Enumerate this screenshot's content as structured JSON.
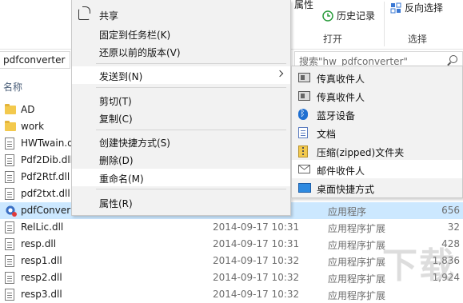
{
  "ribbon": {
    "properties_label": "属性",
    "history_label": "历史记录",
    "invert_selection_label": "反向选择",
    "open_group": "打开",
    "select_group": "选择"
  },
  "address": {
    "path": "pdfconverter",
    "search_placeholder": "搜索\"hw_pdfconverter\""
  },
  "column_header": {
    "name": "名称"
  },
  "files": [
    {
      "name": "AD",
      "date": "",
      "type": "",
      "size": "",
      "icon": "folder-icon"
    },
    {
      "name": "work",
      "date": "",
      "type": "",
      "size": "",
      "icon": "folder-icon"
    },
    {
      "name": "HWTwain.d",
      "date": "",
      "type": "",
      "size": "",
      "icon": "dll-file-icon"
    },
    {
      "name": "Pdf2Dib.dll",
      "date": "",
      "type": "",
      "size": "",
      "icon": "dll-file-icon"
    },
    {
      "name": "Pdf2Rtf.dll",
      "date": "",
      "type": "",
      "size": "",
      "icon": "dll-file-icon"
    },
    {
      "name": "pdf2txt.dll",
      "date": "",
      "type": "",
      "size": "",
      "icon": "dll-file-icon"
    },
    {
      "name": "pdfConver",
      "date": "",
      "type": "应用程序",
      "size": "656",
      "icon": "app-icon"
    },
    {
      "name": "RelLic.dll",
      "date": "2014-09-17 10:31",
      "type": "应用程序扩展",
      "size": "32",
      "icon": "dll-file-icon"
    },
    {
      "name": "resp.dll",
      "date": "2014-09-17 10:31",
      "type": "应用程序扩展",
      "size": "428",
      "icon": "dll-file-icon"
    },
    {
      "name": "resp1.dll",
      "date": "2014-09-17 10:32",
      "type": "应用程序扩展",
      "size": "1,836",
      "icon": "dll-file-icon"
    },
    {
      "name": "resp2.dll",
      "date": "2014-09-17 10:32",
      "type": "应用程序扩展",
      "size": "1,924",
      "icon": "dll-file-icon"
    },
    {
      "name": "resp3.dll",
      "date": "2014-09-17 10:32",
      "type": "应用程序扩展",
      "size": "",
      "icon": "dll-file-icon"
    }
  ],
  "context_menu": {
    "share": "共享",
    "pin_taskbar": "固定到任务栏(K)",
    "restore_versions": "还原以前的版本(V)",
    "send_to": "发送到(N)",
    "cut": "剪切(T)",
    "copy": "复制(C)",
    "create_shortcut": "创建快捷方式(S)",
    "delete": "删除(D)",
    "rename": "重命名(M)",
    "properties": "属性(R)"
  },
  "send_to_menu": {
    "fax1": "传真收件人",
    "fax2": "传真收件人",
    "bluetooth": "蓝牙设备",
    "documents": "文档",
    "zip": "压缩(zipped)文件夹",
    "mail": "邮件收件人",
    "desktop": "桌面快捷方式"
  },
  "watermark": "下载"
}
